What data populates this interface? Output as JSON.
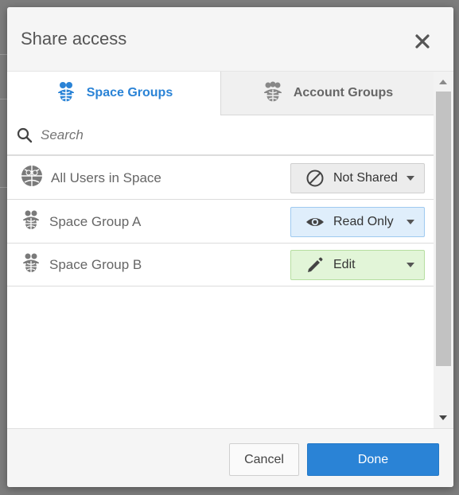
{
  "dialog": {
    "title": "Share access",
    "close_icon": "close-icon"
  },
  "tabs": [
    {
      "label": "Space Groups",
      "icon": "groups-icon",
      "active": true
    },
    {
      "label": "Account Groups",
      "icon": "groups-icon",
      "active": false
    }
  ],
  "search": {
    "placeholder": "Search",
    "value": "",
    "icon": "search-icon"
  },
  "rows": [
    {
      "label": "All Users in Space",
      "icon": "globe-users-icon",
      "permission": "Not Shared",
      "permission_icon": "blocked-icon"
    },
    {
      "label": "Space Group A",
      "icon": "group-icon",
      "permission": "Read Only",
      "permission_icon": "eye-icon"
    },
    {
      "label": "Space Group B",
      "icon": "group-icon",
      "permission": "Edit",
      "permission_icon": "pencil-icon"
    }
  ],
  "footer": {
    "cancel_label": "Cancel",
    "done_label": "Done"
  },
  "colors": {
    "accent": "#2a83d6",
    "read_only_bg": "#dfeefb",
    "edit_bg": "#e2f5d8",
    "not_shared_bg": "#ececec"
  }
}
